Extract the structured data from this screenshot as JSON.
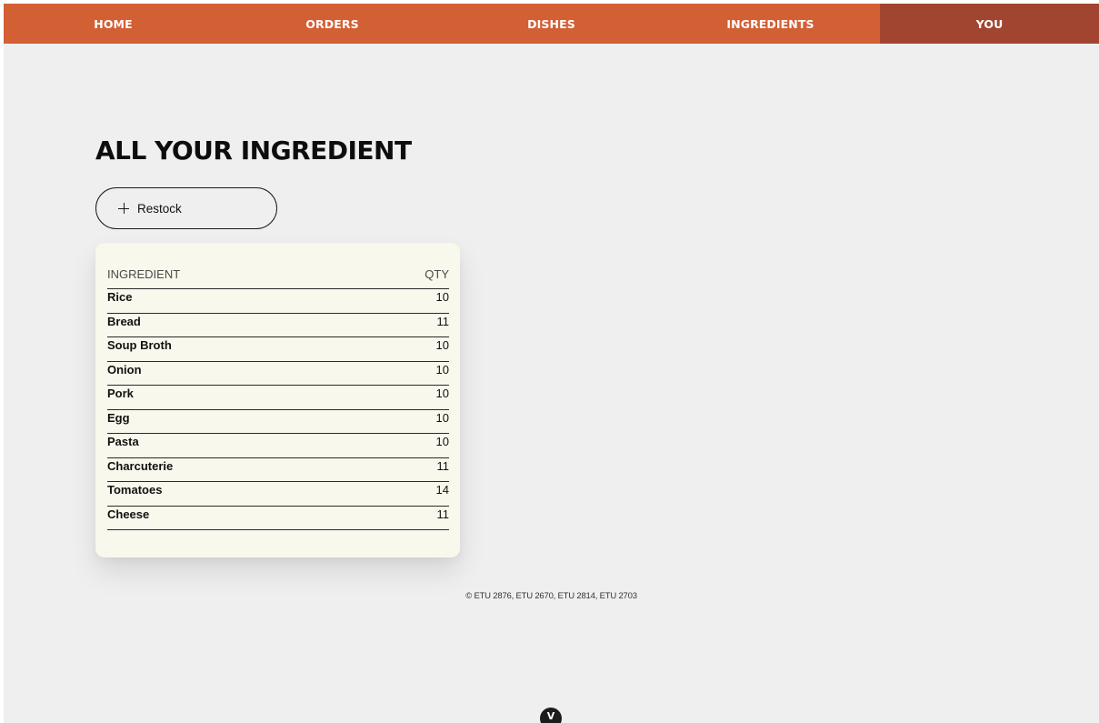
{
  "nav": {
    "items": [
      {
        "label": "HOME"
      },
      {
        "label": "ORDERS"
      },
      {
        "label": "DISHES"
      },
      {
        "label": "INGREDIENTS"
      },
      {
        "label": "YOU"
      }
    ],
    "active": "YOU"
  },
  "page": {
    "title": "ALL YOUR INGREDIENT"
  },
  "restock": {
    "icon": "plus-icon",
    "label": "Restock"
  },
  "table": {
    "headers": {
      "ingredient": "INGREDIENT",
      "qty": "QTY"
    },
    "rows": [
      {
        "name": "Rice",
        "qty": "10"
      },
      {
        "name": "Bread",
        "qty": "11"
      },
      {
        "name": "Soup Broth",
        "qty": "10"
      },
      {
        "name": "Onion",
        "qty": "10"
      },
      {
        "name": "Pork",
        "qty": "10"
      },
      {
        "name": "Egg",
        "qty": "10"
      },
      {
        "name": "Pasta",
        "qty": "10"
      },
      {
        "name": "Charcuterie",
        "qty": "11"
      },
      {
        "name": "Tomatoes",
        "qty": "14"
      },
      {
        "name": "Cheese",
        "qty": "11"
      }
    ]
  },
  "footer": {
    "text": "© ETU 2876, ETU 2670, ETU 2814, ETU 2703"
  },
  "scroll": {
    "icon": "chevron-down-icon",
    "glyph": "V"
  },
  "colors": {
    "nav_bg": "#d35f35",
    "nav_active_bg": "#a24530",
    "page_bg": "#efefef",
    "card_bg": "#f8f8ec"
  }
}
